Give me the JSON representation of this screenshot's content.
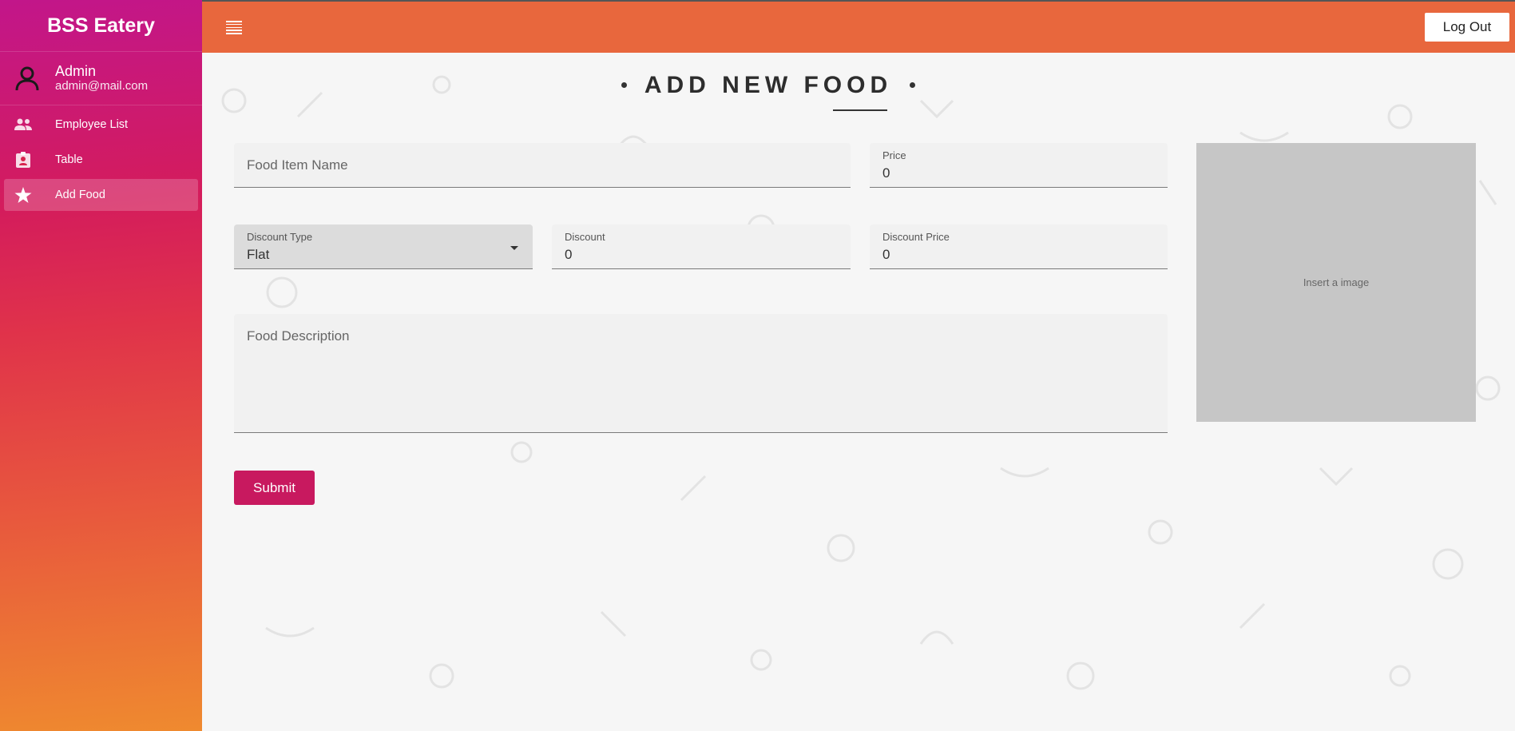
{
  "sidebar": {
    "brand": "BSS Eatery",
    "user": {
      "name": "Admin",
      "email": "admin@mail.com"
    },
    "items": [
      {
        "label": "Employee List",
        "icon": "people-icon",
        "active": false
      },
      {
        "label": "Table",
        "icon": "clipboard-user-icon",
        "active": false
      },
      {
        "label": "Add Food",
        "icon": "star-icon",
        "active": true
      }
    ]
  },
  "header": {
    "logout_label": "Log Out"
  },
  "main": {
    "title": "ADD NEW FOOD",
    "food_item_name": {
      "placeholder": "Food Item Name",
      "value": ""
    },
    "price": {
      "label": "Price",
      "value": "0"
    },
    "discount_type": {
      "label": "Discount Type",
      "value": "Flat"
    },
    "discount": {
      "label": "Discount",
      "value": "0"
    },
    "discount_price": {
      "label": "Discount Price",
      "value": "0"
    },
    "food_description": {
      "placeholder": "Food Description",
      "value": ""
    },
    "image_placeholder": "Insert a image",
    "submit_label": "Submit"
  },
  "colors": {
    "header": "#e8673d",
    "submit": "#c8195f",
    "sidebar_top": "#c2168a",
    "sidebar_bottom": "#ef8a2f"
  }
}
